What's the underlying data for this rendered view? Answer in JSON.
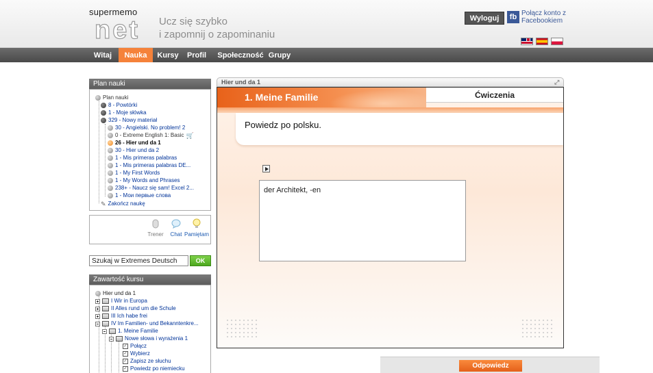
{
  "header": {
    "logo_top": "supermemo",
    "logo_net": "net",
    "tagline_line1": "Ucz się szybko",
    "tagline_line2": "i zapomnij o zapominaniu",
    "logout_label": "Wyloguj",
    "fb_label": "fb",
    "fb_connect_line1": "Połącz konto z",
    "fb_connect_line2": "Facebookiem",
    "flags": [
      "uk-flag-icon",
      "spain-flag-icon",
      "poland-flag-icon"
    ]
  },
  "nav": {
    "items": [
      {
        "label": "Witaj",
        "active": false
      },
      {
        "label": "Nauka",
        "active": true
      },
      {
        "label": "Kursy",
        "active": false
      },
      {
        "label": "Profil",
        "active": false
      },
      {
        "label": "Społeczność",
        "active": false
      },
      {
        "label": "Grupy",
        "active": false
      }
    ],
    "active_color": "#f5823a"
  },
  "plan": {
    "title": "Plan nauki",
    "root": "Plan nauki",
    "items": [
      "8 - Powtórki",
      "1 - Moje słówka",
      "329 - Nowy materiał",
      "30 - Angielski. No problem! 2",
      "0 - Extreme English 1: Basic",
      "26 - Hier und da 1",
      "30 - Hier und da 2",
      "1 - Mis primeras palabras",
      "1 - Mis primeras palabras DE...",
      "1 - My First Words",
      "1 - My Words and Phrases",
      "238+ - Naucz się sam! Excel 2...",
      "1 - Мои первые слова"
    ],
    "finish": "Zakończ naukę"
  },
  "tools": {
    "trainer": "Trener",
    "chat": "Chat",
    "memory": "Pamiętam"
  },
  "search": {
    "value": "Szukaj w Extremes Deutsch",
    "ok_label": "OK"
  },
  "course": {
    "title": "Zawartość kursu",
    "root": "Hier und da 1",
    "items": [
      "I Wir in Europa",
      "II Alles rund um die Schule",
      "III Ich habe frei",
      "IV Im Familien- und Bekanntenkre...",
      "1. Meine Familie",
      "Nowe słowa i wyrażenia 1",
      "Połącz",
      "Wybierz",
      "Zapisz ze słuchu",
      "Powiedz po niemiecku"
    ]
  },
  "main": {
    "title": "Hier und da 1",
    "banner_title": "1. Meine Familie",
    "tab_label": "Ćwiczenia",
    "question": "Powiedz po polsku.",
    "answer": "der Architekt, -en",
    "submit_label": "Odpowiedz"
  },
  "colors": {
    "accent": "#f5823a",
    "nav_bg": "#555555",
    "facebook": "#3b5998",
    "ok_green": "#4ca81e"
  }
}
